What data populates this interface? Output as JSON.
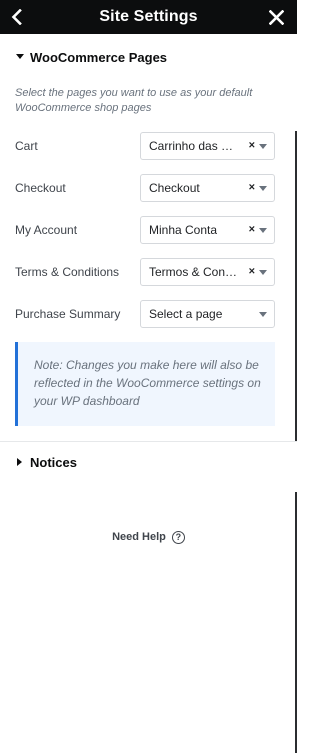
{
  "header": {
    "title": "Site Settings",
    "back_icon": "chevron-left-icon",
    "close_icon": "close-icon"
  },
  "woocommerce_section": {
    "title": "WooCommerce Pages",
    "expanded": true,
    "description": "Select the pages you want to use as your default WooCommerce shop pages",
    "fields": [
      {
        "label": "Cart",
        "value": "Carrinho das Co…",
        "clearable": true
      },
      {
        "label": "Checkout",
        "value": "Checkout",
        "clearable": true
      },
      {
        "label": "My Account",
        "value": "Minha Conta",
        "clearable": true
      },
      {
        "label": "Terms & Conditions",
        "value": "Termos & Condi…",
        "clearable": true
      },
      {
        "label": "Purchase Summary",
        "value": "Select a page",
        "clearable": false
      }
    ],
    "clear_glyph": "×",
    "note": "Note: Changes you make here will also be reflected in the WooCommerce settings on your WP dashboard"
  },
  "notices_section": {
    "title": "Notices",
    "expanded": false
  },
  "help": {
    "label": "Need Help",
    "icon": "question-circle-icon",
    "glyph": "?"
  },
  "colors": {
    "header_bg": "#0c0d0e",
    "note_bg": "#f0f6fe",
    "note_border": "#2271d8"
  }
}
